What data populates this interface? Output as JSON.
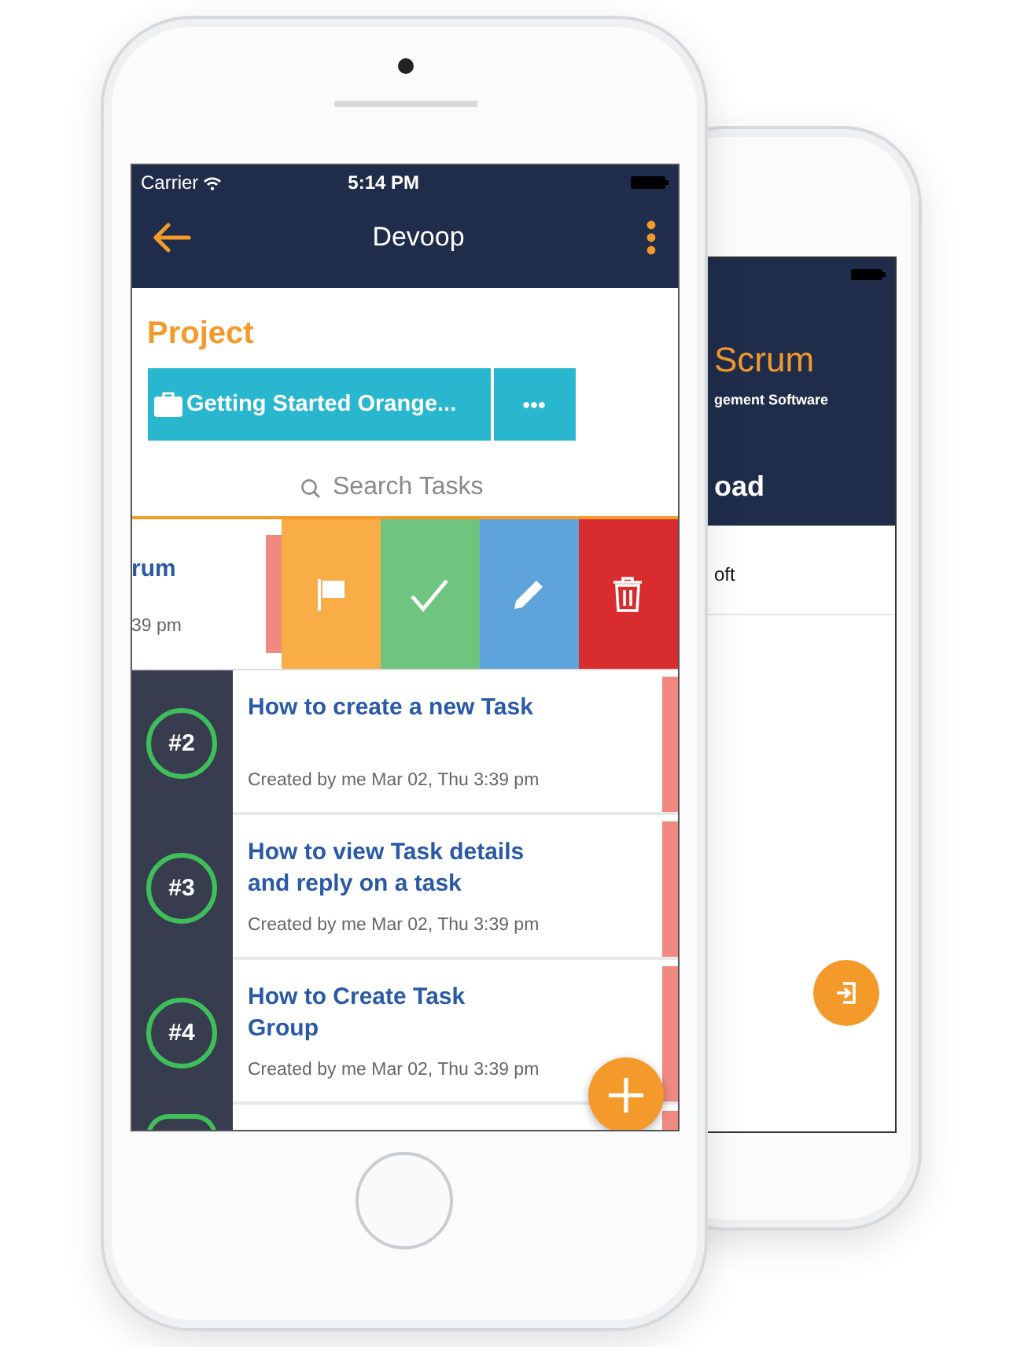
{
  "front_screen": {
    "status_bar": {
      "carrier": "Carrier",
      "time": "5:14 PM"
    },
    "header": {
      "title": "Devoop"
    },
    "project": {
      "label": "Project",
      "name": "Getting Started Orange...",
      "more": "•••"
    },
    "search": {
      "placeholder": "Search Tasks"
    },
    "swiped_task": {
      "title": "rum",
      "meta": "39 pm",
      "actions": [
        {
          "kind": "flag",
          "color": "#f8ad47"
        },
        {
          "kind": "check",
          "color": "#6fc47f"
        },
        {
          "kind": "edit",
          "color": "#5fa3dc"
        },
        {
          "kind": "delete",
          "color": "#d92c2f"
        }
      ]
    },
    "tasks": [
      {
        "number": "#2",
        "title": "How to create a new Task",
        "meta": "Created by me Mar 02, Thu 3:39 pm"
      },
      {
        "number": "#3",
        "title": "How to view Task details and reply on a task",
        "meta": "Created by me Mar 02, Thu 3:39 pm"
      },
      {
        "number": "#4",
        "title": "How to Create Task Group",
        "meta": "Created by me Mar 02, Thu 3:39 pm"
      }
    ]
  },
  "back_screen": {
    "title": "Scrum",
    "subtitle": "gement Software",
    "heading": "oad",
    "item": "oft"
  }
}
